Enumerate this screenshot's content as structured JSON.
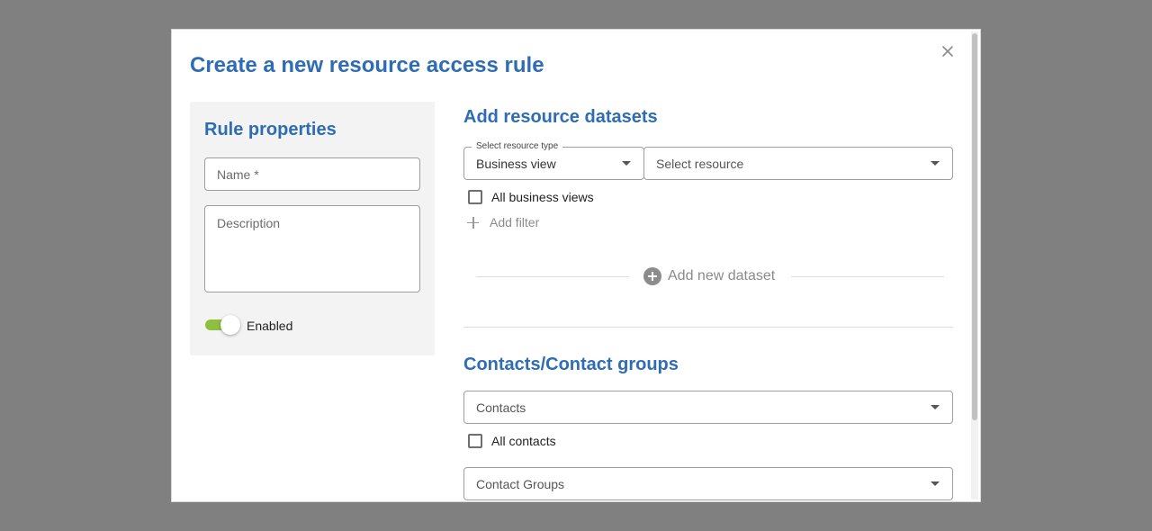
{
  "dialog": {
    "title": "Create a new resource access rule",
    "close_icon": "close-icon"
  },
  "rule_properties": {
    "heading": "Rule properties",
    "name_placeholder": "Name *",
    "description_placeholder": "Description",
    "enabled_label": "Enabled",
    "enabled": true
  },
  "resource_datasets": {
    "heading": "Add resource datasets",
    "resource_type_label": "Select resource type",
    "resource_type_value": "Business view",
    "resource_placeholder": "Select resource",
    "all_checkbox_label": "All business views",
    "add_filter_label": "Add filter",
    "add_dataset_label": "Add new dataset"
  },
  "contacts": {
    "heading": "Contacts/Contact groups",
    "contacts_placeholder": "Contacts",
    "all_contacts_label": "All contacts",
    "contact_groups_placeholder": "Contact Groups"
  },
  "colors": {
    "accent": "#2e6db4",
    "toggle_on": "#8fbf3f",
    "overlay": "#808080"
  }
}
